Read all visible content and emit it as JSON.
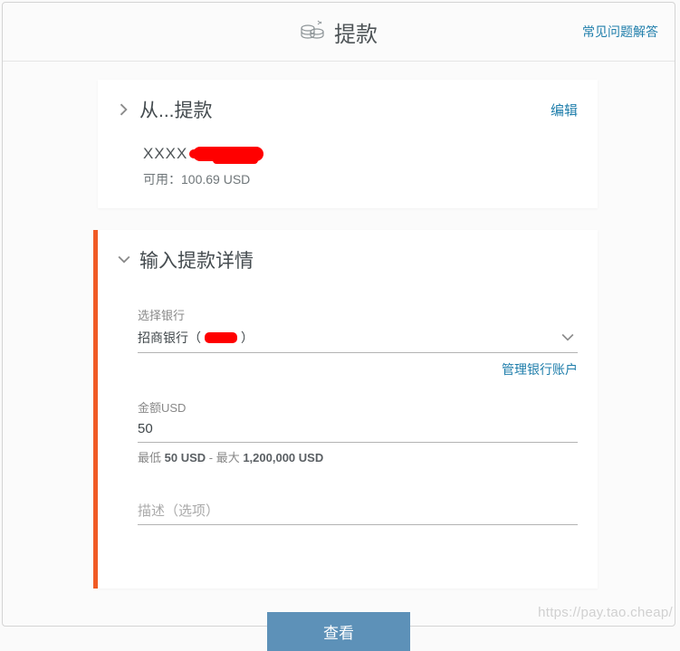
{
  "header": {
    "title": "提款",
    "faq": "常见问题解答"
  },
  "from": {
    "title": "从...提款",
    "edit": "编辑",
    "account_prefix": "XXXX",
    "available_label": "可用：",
    "available_value": "100.69 USD"
  },
  "details": {
    "title": "输入提款详情",
    "bank_label": "选择银行",
    "bank_value_prefix": "招商银行（",
    "bank_value_suffix": "）",
    "manage": "管理银行账户",
    "amount_label": "金额USD",
    "amount_value": "50",
    "hint_prefix": "最低 ",
    "hint_min": "50 USD",
    "hint_mid": " - 最大 ",
    "hint_max": "1,200,000 USD",
    "desc_placeholder": "描述（选项）"
  },
  "submit": "查看",
  "watermark": "https://pay.tao.cheap/"
}
